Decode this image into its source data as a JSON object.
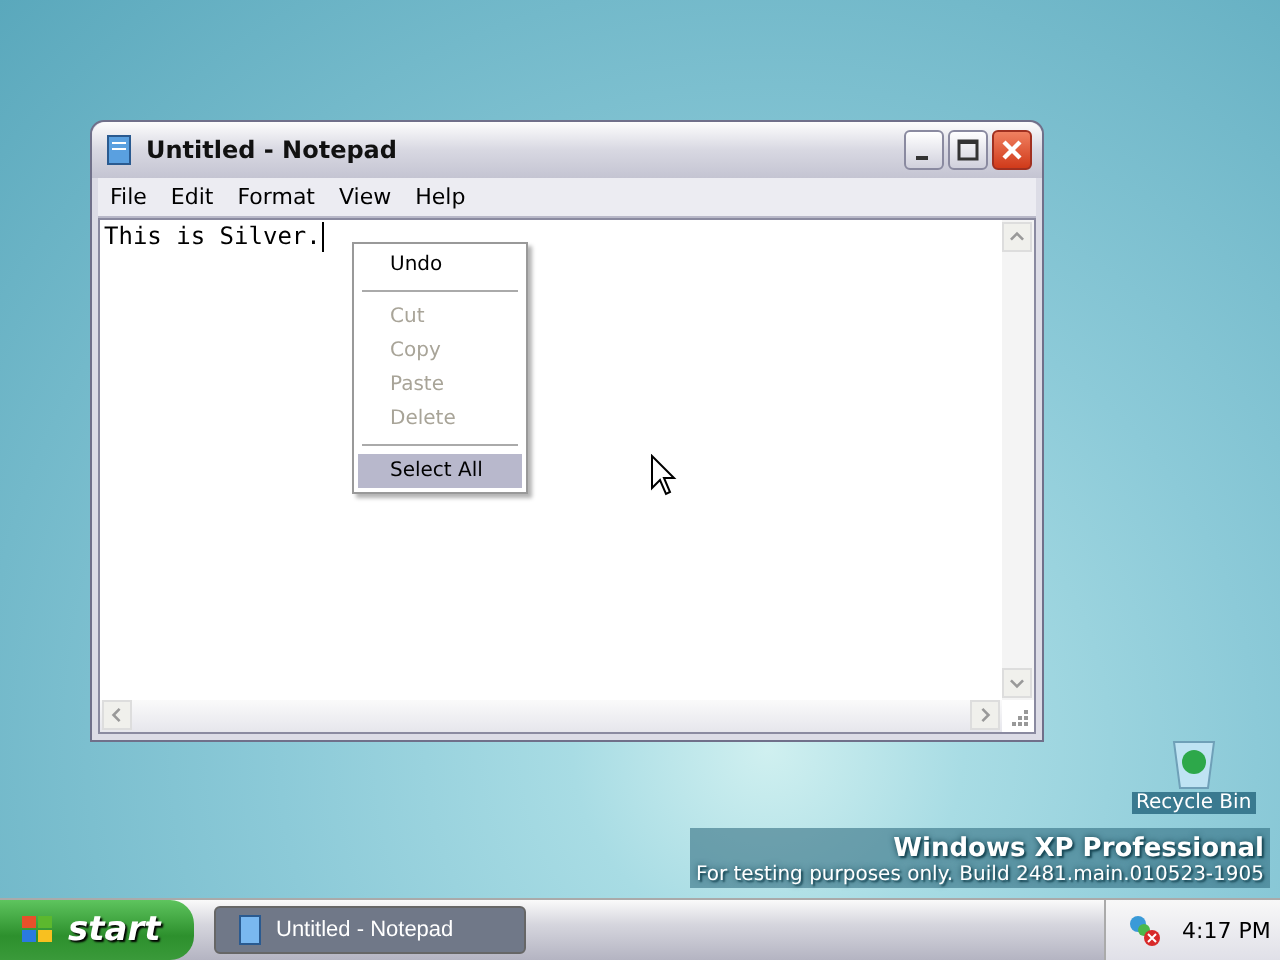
{
  "window": {
    "title": "Untitled - Notepad"
  },
  "menu_bar": [
    "File",
    "Edit",
    "Format",
    "View",
    "Help"
  ],
  "editor": {
    "text": "This is Silver."
  },
  "context_menu": [
    {
      "kind": "item",
      "label": "Undo",
      "disabled": false,
      "selected": false
    },
    {
      "kind": "separator"
    },
    {
      "kind": "item",
      "label": "Cut",
      "disabled": true,
      "selected": false
    },
    {
      "kind": "item",
      "label": "Copy",
      "disabled": true,
      "selected": false
    },
    {
      "kind": "item",
      "label": "Paste",
      "disabled": true,
      "selected": false
    },
    {
      "kind": "item",
      "label": "Delete",
      "disabled": true,
      "selected": false
    },
    {
      "kind": "separator"
    },
    {
      "kind": "item",
      "label": "Select All",
      "disabled": false,
      "selected": true
    }
  ],
  "desktop": {
    "icon_label": "Recycle Bin",
    "edition": "Windows XP Professional",
    "build_note": "For testing purposes only. Build 2481.main.010523-1905"
  },
  "taskbar": {
    "start": "start",
    "tasks": [
      {
        "label": "Untitled - Notepad",
        "selected": true
      }
    ],
    "clock": "4:17 PM"
  }
}
